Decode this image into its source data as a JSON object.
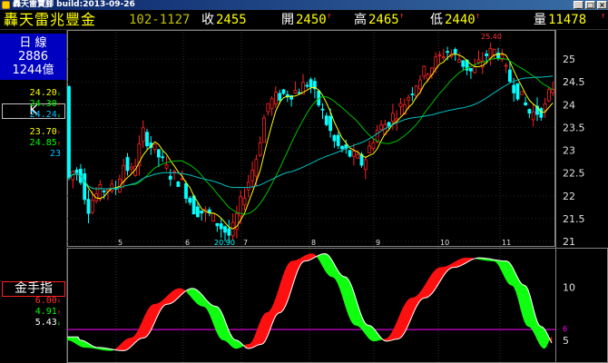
{
  "window": {
    "title": "轟天雷寶腳 build:2013-09-26",
    "minimize": "_",
    "maximize": "□",
    "close": "×"
  },
  "quote": {
    "name": "轟天雷兆豐金",
    "code": "102-1127",
    "close_label": "收",
    "close_value": "2455",
    "open_label": "開",
    "open_value": "2450",
    "high_label": "高",
    "high_value": "2465",
    "low_label": "低",
    "low_value": "2440",
    "volume_label": "量",
    "volume_value": "11478",
    "up_arrow": "↑"
  },
  "sidebar": {
    "period_label": "日 線",
    "value_1": "2886",
    "value_2": "1244億",
    "chart_type": "K",
    "ma_values": [
      {
        "text": "24.20",
        "color": "#ffff00",
        "arrow": "↓",
        "arrow_color": "#00ff00"
      },
      {
        "text": "24.30",
        "color": "#00ff00",
        "arrow": "↑",
        "arrow_color": "#ff3030"
      },
      {
        "text": "24.24",
        "color": "#00c0ff",
        "arrow": "↓",
        "arrow_color": "#00ff00"
      }
    ],
    "ma_values_2": [
      {
        "text": "23.70",
        "color": "#ffff00",
        "arrow": "↑",
        "arrow_color": "#ff3030"
      },
      {
        "text": "24.85",
        "color": "#00ff00",
        "arrow": "↑",
        "arrow_color": "#ff3030"
      },
      {
        "text": "23",
        "color": "#00c0ff",
        "arrow": "",
        "arrow_color": "#00ff00"
      }
    ],
    "indicator_label": "金手指",
    "indicator_values": [
      {
        "text": "6.00",
        "color": "#ff3030",
        "arrow": "↑",
        "arrow_color": "#ff3030"
      },
      {
        "text": "4.91",
        "color": "#00ff00",
        "arrow": "↑",
        "arrow_color": "#ff3030"
      },
      {
        "text": "5.43",
        "color": "#ffffff",
        "arrow": "↓",
        "arrow_color": "#00ff00"
      }
    ]
  },
  "chart_data": [
    {
      "type": "candlestick",
      "title": "",
      "y_axis_ticks": [
        "25",
        "24.5",
        "24",
        "23.5",
        "23",
        "22.5",
        "22",
        "21.5",
        "21"
      ],
      "ylim": [
        20.9,
        25.6
      ],
      "x_month_ticks": [
        "5",
        "6",
        "7",
        "8",
        "9",
        "10",
        "11"
      ],
      "annotations": {
        "high": "25.40",
        "low": "20.90"
      },
      "series": [
        {
          "name": "MA short",
          "color": "#ffff00"
        },
        {
          "name": "MA mid",
          "color": "#00c000"
        },
        {
          "name": "MA long",
          "color": "#00c0c0"
        }
      ],
      "colors": {
        "up": "#ff2020",
        "down": "#00ffff"
      }
    },
    {
      "type": "area",
      "title": "金手指",
      "y_axis_ticks": [
        "10",
        "5"
      ],
      "reference_line": {
        "value": "6",
        "color": "#ff00ff"
      },
      "colors": {
        "rising": "#ff1010",
        "falling": "#10ff10",
        "signal": "#ffffff"
      }
    }
  ]
}
